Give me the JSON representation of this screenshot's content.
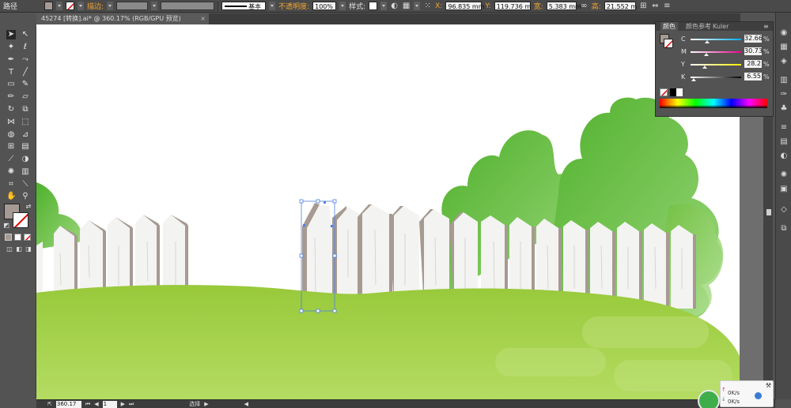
{
  "window": {
    "object_type": "路径",
    "doc_tab": "45274 [转换].ai* @ 360.17% (RGB/GPU 预览)",
    "tab_close": "×"
  },
  "control_bar": {
    "stroke_label": "描边:",
    "stroke_style": "基本",
    "opacity_label": "不透明度:",
    "opacity_value": "100%",
    "style_label": "样式:",
    "x_label": "X:",
    "x_value": "96.835 mm",
    "y_label": "Y:",
    "y_value": "119.736 m",
    "w_label": "宽:",
    "w_value": "5.383 mm",
    "h_label": "高:",
    "h_value": "21.552 m"
  },
  "color_panel": {
    "tabs": [
      "颜色",
      "颜色参考",
      "Kuler"
    ],
    "channels": [
      {
        "label": "C",
        "value": "32.66",
        "fraction": 0.33,
        "track": "linear-gradient(to right,#fff,#00aeef)"
      },
      {
        "label": "M",
        "value": "30.73",
        "fraction": 0.31,
        "track": "linear-gradient(to right,#fff,#ec008c)"
      },
      {
        "label": "Y",
        "value": "28.2",
        "fraction": 0.28,
        "track": "linear-gradient(to right,#fff,#fff200)"
      },
      {
        "label": "K",
        "value": "6.55",
        "fraction": 0.07,
        "track": "linear-gradient(to right,#fff,#000)"
      }
    ],
    "percent": "%",
    "fill_color": "#a59b94"
  },
  "status_bar": {
    "zoom": "360.17",
    "page": "1",
    "status": "选择"
  },
  "network": {
    "up": "0K/s",
    "down": "0K/s"
  },
  "colors": {
    "grass": "#9ccc3c",
    "bush": "#5bb836",
    "fence": "#f3f3f1",
    "fence_edge": "#a69a92",
    "selection": "#4f7fe0"
  }
}
